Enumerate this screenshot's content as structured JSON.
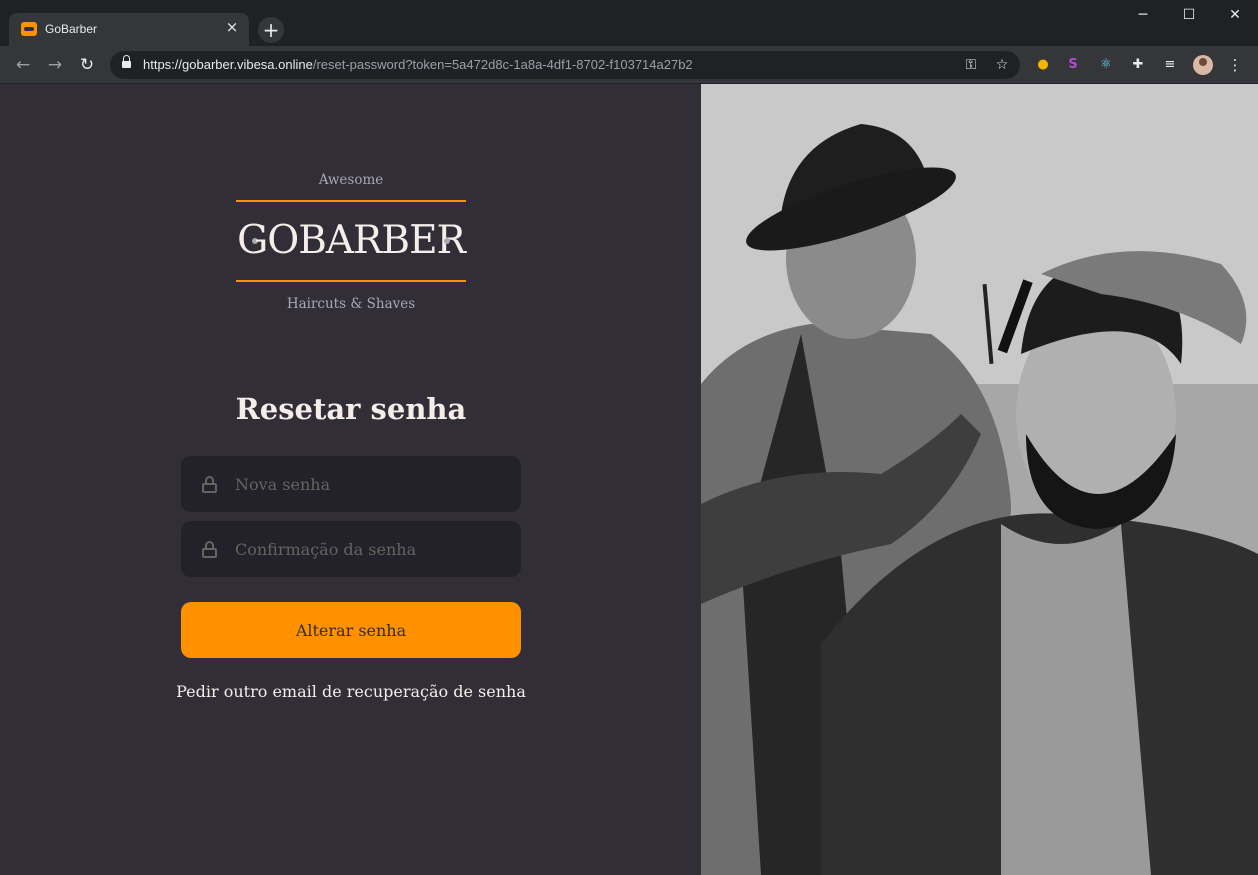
{
  "browser": {
    "tab": {
      "title": "GoBarber",
      "close_icon": "×"
    },
    "new_tab_icon": "+",
    "window_controls": {
      "minimize": "─",
      "maximize": "☐",
      "close": "✕"
    },
    "nav": {
      "back": "←",
      "forward": "→",
      "reload": "↻"
    },
    "url": {
      "host": "https://gobarber.vibesa.online",
      "path": "/reset-password?token=5a472d8c-1a8a-4df1-8702-f103714a27b2"
    },
    "omnibox_icons": {
      "key": "⚿",
      "star": "☆"
    },
    "extensions": [
      "●",
      "S",
      "⚛",
      "✚",
      "≡"
    ],
    "menu": "⋮"
  },
  "logo": {
    "top_text": "Awesome",
    "name": "GOBARBER",
    "bottom_text": "Haircuts & Shaves"
  },
  "form": {
    "title": "Resetar senha",
    "password_placeholder": "Nova senha",
    "confirmation_placeholder": "Confirmação da senha",
    "submit_label": "Alterar senha",
    "link_label": "Pedir outro email de recuperação de senha"
  },
  "colors": {
    "background": "#312e38",
    "input_background": "#232129",
    "accent": "#ff9000",
    "text": "#f4ede8",
    "placeholder": "#666360"
  }
}
